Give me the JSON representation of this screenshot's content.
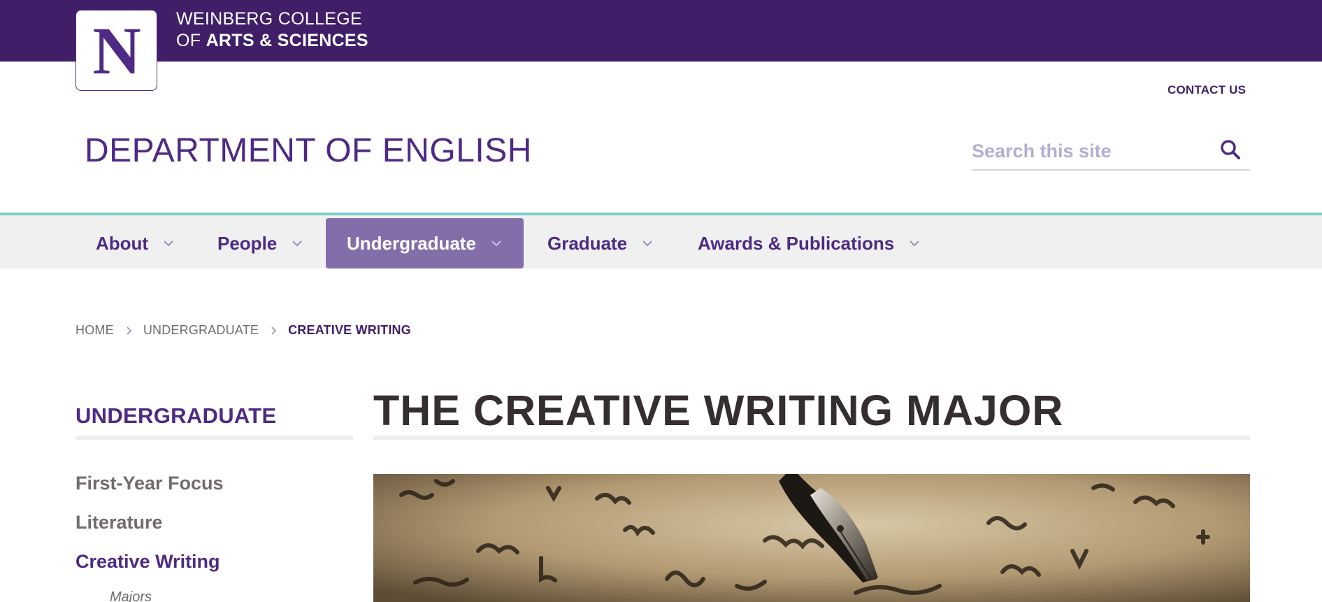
{
  "header": {
    "college_line1": "WEINBERG COLLEGE",
    "college_line2_prefix": "OF",
    "college_line2_bold": "ARTS & SCIENCES",
    "logo_letter": "N",
    "contact_label": "CONTACT US",
    "department": "DEPARTMENT OF ENGLISH"
  },
  "search": {
    "placeholder": "Search this site",
    "icon": "search-icon"
  },
  "nav": {
    "items": [
      {
        "label": "About"
      },
      {
        "label": "People"
      },
      {
        "label": "Undergraduate"
      },
      {
        "label": "Graduate"
      },
      {
        "label": "Awards & Publications"
      }
    ],
    "active": "Undergraduate"
  },
  "breadcrumb": {
    "items": [
      "HOME",
      "UNDERGRADUATE",
      "CREATIVE WRITING"
    ]
  },
  "sidebar": {
    "title": "UNDERGRADUATE",
    "items": [
      {
        "label": "First-Year Focus"
      },
      {
        "label": "Literature"
      },
      {
        "label": "Creative Writing"
      }
    ],
    "sub_items": [
      {
        "label": "Majors"
      }
    ],
    "active": "Creative Writing"
  },
  "main": {
    "title": "THE CREATIVE WRITING MAJOR",
    "hero_image": "fountain-pen-handwriting-image"
  },
  "colors": {
    "brand_purple": "#4e2a84",
    "dark_purple": "#401f68",
    "active_nav": "#836eaa",
    "accent_teal": "#7fcecd"
  }
}
